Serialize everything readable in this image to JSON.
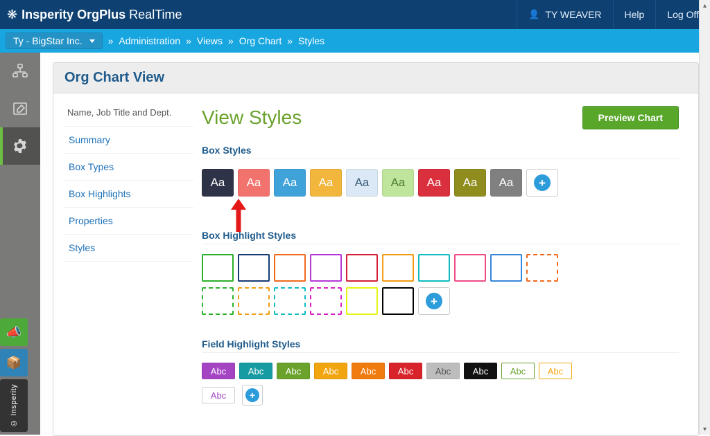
{
  "topbar": {
    "brand_a": "Insperity",
    "brand_b": "OrgPlus",
    "brand_c": "RealTime",
    "user": "TY WEAVER",
    "help": "Help",
    "logoff": "Log Off"
  },
  "crumb": {
    "org": "Ty - BigStar Inc.",
    "items": [
      "Administration",
      "Views",
      "Org Chart",
      "Styles"
    ]
  },
  "leftrail": {
    "insperity_label": "© Insperity"
  },
  "panel": {
    "head": "Org Chart View",
    "static_caption": "Name, Job Title and Dept.",
    "nav": {
      "summary": "Summary",
      "boxtypes": "Box Types",
      "boxhighlights": "Box Highlights",
      "properties": "Properties",
      "styles": "Styles"
    },
    "title": "View Styles",
    "preview_btn": "Preview Chart",
    "sections": {
      "box_styles": "Box Styles",
      "box_highlight_styles": "Box Highlight Styles",
      "field_highlight_styles": "Field Highlight Styles"
    },
    "box_styles": [
      {
        "bg": "#2f3348",
        "fg": "#ffffff",
        "label": "Aa"
      },
      {
        "bg": "#f2736e",
        "fg": "#ffffff",
        "label": "Aa"
      },
      {
        "bg": "#3fa2d9",
        "fg": "#ffffff",
        "label": "Aa"
      },
      {
        "bg": "#f2b63c",
        "fg": "#ffffff",
        "label": "Aa"
      },
      {
        "bg": "#dae9f5",
        "fg": "#3b5d77",
        "label": "Aa"
      },
      {
        "bg": "#bfe59c",
        "fg": "#4a7a2e",
        "label": "Aa"
      },
      {
        "bg": "#da2f3d",
        "fg": "#ffffff",
        "label": "Aa"
      },
      {
        "bg": "#8e8d1e",
        "fg": "#ffffff",
        "label": "Aa"
      },
      {
        "bg": "#808080",
        "fg": "#ffffff",
        "label": "Aa"
      }
    ],
    "box_highlights_row1": [
      {
        "style": "solid",
        "color": "#2bb02b"
      },
      {
        "style": "solid",
        "color": "#153a74"
      },
      {
        "style": "solid",
        "color": "#f16a1c"
      },
      {
        "style": "solid",
        "color": "#b537d8"
      },
      {
        "style": "solid",
        "color": "#d21f36"
      },
      {
        "style": "solid",
        "color": "#f39b12"
      },
      {
        "style": "solid",
        "color": "#11bcc0"
      },
      {
        "style": "solid",
        "color": "#ee4d87"
      },
      {
        "style": "solid",
        "color": "#3686db"
      },
      {
        "style": "dashed",
        "color": "#f16a1c"
      }
    ],
    "box_highlights_row2": [
      {
        "style": "dashed",
        "color": "#2bb02b"
      },
      {
        "style": "dashed",
        "color": "#f39b12"
      },
      {
        "style": "dashed",
        "color": "#11bcc0"
      },
      {
        "style": "dashed",
        "color": "#d81fc1"
      },
      {
        "style": "solid",
        "color": "#e4f50f"
      },
      {
        "style": "solid",
        "color": "#000000"
      }
    ],
    "field_highlights": [
      {
        "bg": "#a444c3",
        "fg": "#ffffff",
        "label": "Abc",
        "outlined": false
      },
      {
        "bg": "#159ba1",
        "fg": "#ffffff",
        "label": "Abc",
        "outlined": false
      },
      {
        "bg": "#6aa22c",
        "fg": "#ffffff",
        "label": "Abc",
        "outlined": false
      },
      {
        "bg": "#f1a50f",
        "fg": "#ffffff",
        "label": "Abc",
        "outlined": false
      },
      {
        "bg": "#f07b0f",
        "fg": "#ffffff",
        "label": "Abc",
        "outlined": false
      },
      {
        "bg": "#d8232a",
        "fg": "#ffffff",
        "label": "Abc",
        "outlined": false
      },
      {
        "bg": "#bdbdbd",
        "fg": "#555555",
        "label": "Abc",
        "outlined": false
      },
      {
        "bg": "#111111",
        "fg": "#ffffff",
        "label": "Abc",
        "outlined": false
      },
      {
        "bg": "#ffffff",
        "fg": "#6aa22c",
        "label": "Abc",
        "outlined": true,
        "border": "#6aa22c"
      },
      {
        "bg": "#ffffff",
        "fg": "#f1a50f",
        "label": "Abc",
        "outlined": true,
        "border": "#f1a50f"
      }
    ],
    "field_highlights_row2": [
      {
        "bg": "#ffffff",
        "fg": "#a444c3",
        "label": "Abc",
        "outlined": true,
        "border": "#cfcfcf"
      }
    ]
  }
}
